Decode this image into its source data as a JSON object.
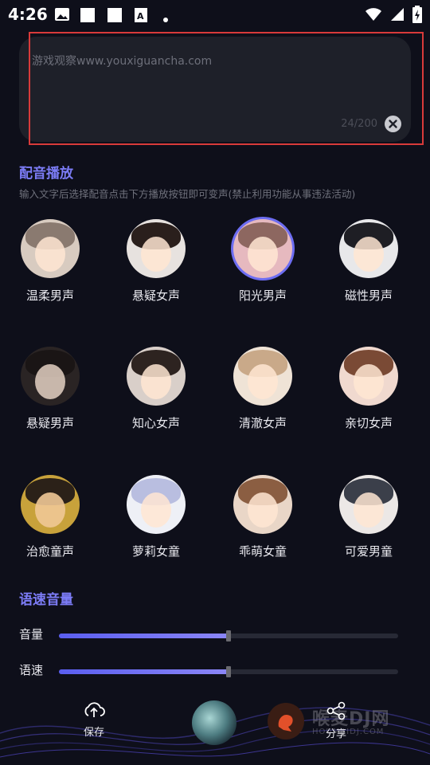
{
  "status_bar": {
    "time": "4:26",
    "icons": [
      "image-icon",
      "notification-doc-icon",
      "notification-doc-icon",
      "font-app-icon",
      "dot-icon",
      "wifi-icon",
      "signal-icon",
      "battery-charging-icon"
    ]
  },
  "text_input": {
    "value": "游戏观察www.youxiguancha.com",
    "counter": "24/200"
  },
  "voice_section": {
    "title": "配音播放",
    "subtitle": "输入文字后选择配音点击下方播放按钮即可变声(禁止利用功能从事违法活动)",
    "voices": [
      {
        "label": "温柔男声"
      },
      {
        "label": "悬疑女声"
      },
      {
        "label": "阳光男声"
      },
      {
        "label": "磁性男声"
      },
      {
        "label": "悬疑男声"
      },
      {
        "label": "知心女声"
      },
      {
        "label": "清澈女声"
      },
      {
        "label": "亲切女声"
      },
      {
        "label": "治愈童声"
      },
      {
        "label": "萝莉女童"
      },
      {
        "label": "乖萌女童"
      },
      {
        "label": "可爱男童"
      }
    ],
    "selected_label": "阳光男声"
  },
  "speed_volume": {
    "title": "语速音量",
    "volume_label": "音量",
    "volume_value": 0.5,
    "speed_label": "语速",
    "speed_value": 0.5
  },
  "bottom_bar": {
    "save_label": "保存",
    "share_label": "分享",
    "watermark_text": "喉麦DJ网",
    "watermark_sub": "HOUMAIDJ.COM"
  },
  "colors": {
    "background": "#0e0f1a",
    "accent": "#7c7cf6",
    "highlight": "#d83a3a"
  }
}
